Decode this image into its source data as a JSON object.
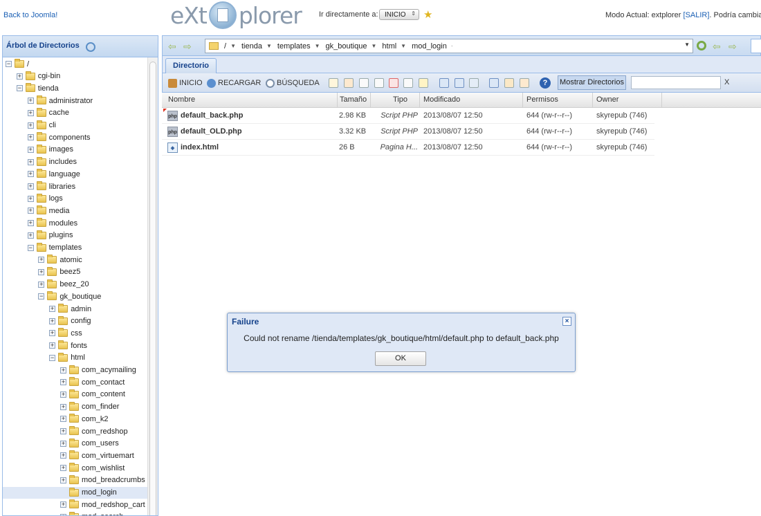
{
  "header": {
    "back_link": "Back to Joomla!",
    "logo_left": "eXt",
    "logo_right": "plorer",
    "goto_label": "Ir directamente a:",
    "goto_value": "INICIO",
    "mode_prefix": "Modo Actual: extplorer ",
    "mode_salir": "[SALIR]",
    "mode_suffix": ". Podría cambiar"
  },
  "tree": {
    "title": "Árbol de Directorios",
    "items": [
      {
        "label": "/",
        "level": 0,
        "toggle": "minus",
        "open": true
      },
      {
        "label": "cgi-bin",
        "level": 1,
        "toggle": "plus"
      },
      {
        "label": "tienda",
        "level": 1,
        "toggle": "minus",
        "open": true
      },
      {
        "label": "administrator",
        "level": 2,
        "toggle": "plus"
      },
      {
        "label": "cache",
        "level": 2,
        "toggle": "plus"
      },
      {
        "label": "cli",
        "level": 2,
        "toggle": "plus"
      },
      {
        "label": "components",
        "level": 2,
        "toggle": "plus"
      },
      {
        "label": "images",
        "level": 2,
        "toggle": "plus"
      },
      {
        "label": "includes",
        "level": 2,
        "toggle": "plus"
      },
      {
        "label": "language",
        "level": 2,
        "toggle": "plus"
      },
      {
        "label": "libraries",
        "level": 2,
        "toggle": "plus"
      },
      {
        "label": "logs",
        "level": 2,
        "toggle": "plus"
      },
      {
        "label": "media",
        "level": 2,
        "toggle": "plus"
      },
      {
        "label": "modules",
        "level": 2,
        "toggle": "plus"
      },
      {
        "label": "plugins",
        "level": 2,
        "toggle": "plus"
      },
      {
        "label": "templates",
        "level": 2,
        "toggle": "minus",
        "open": true
      },
      {
        "label": "atomic",
        "level": 3,
        "toggle": "plus"
      },
      {
        "label": "beez5",
        "level": 3,
        "toggle": "plus"
      },
      {
        "label": "beez_20",
        "level": 3,
        "toggle": "plus"
      },
      {
        "label": "gk_boutique",
        "level": 3,
        "toggle": "minus",
        "open": true
      },
      {
        "label": "admin",
        "level": 4,
        "toggle": "plus"
      },
      {
        "label": "config",
        "level": 4,
        "toggle": "plus"
      },
      {
        "label": "css",
        "level": 4,
        "toggle": "plus"
      },
      {
        "label": "fonts",
        "level": 4,
        "toggle": "plus"
      },
      {
        "label": "html",
        "level": 4,
        "toggle": "minus",
        "open": true
      },
      {
        "label": "com_acymailing",
        "level": 5,
        "toggle": "plus"
      },
      {
        "label": "com_contact",
        "level": 5,
        "toggle": "plus"
      },
      {
        "label": "com_content",
        "level": 5,
        "toggle": "plus"
      },
      {
        "label": "com_finder",
        "level": 5,
        "toggle": "plus"
      },
      {
        "label": "com_k2",
        "level": 5,
        "toggle": "plus"
      },
      {
        "label": "com_redshop",
        "level": 5,
        "toggle": "plus"
      },
      {
        "label": "com_users",
        "level": 5,
        "toggle": "plus"
      },
      {
        "label": "com_virtuemart",
        "level": 5,
        "toggle": "plus"
      },
      {
        "label": "com_wishlist",
        "level": 5,
        "toggle": "plus"
      },
      {
        "label": "mod_breadcrumbs",
        "level": 5,
        "toggle": "plus"
      },
      {
        "label": "mod_login",
        "level": 5,
        "toggle": "none",
        "selected": true
      },
      {
        "label": "mod_redshop_cart",
        "level": 5,
        "toggle": "plus"
      },
      {
        "label": "mod_search",
        "level": 5,
        "toggle": "plus"
      }
    ]
  },
  "path": {
    "crumbs": [
      "/",
      "tienda",
      "templates",
      "gk_boutique",
      "html",
      "mod_login"
    ]
  },
  "tab": {
    "label": "Directorio"
  },
  "toolbar": {
    "home_label": "INICIO",
    "reload_label": "RECARGAR",
    "search_label": "BÚSQUEDA",
    "show_dirs_label": "Mostrar Directorios",
    "filter_value": "",
    "clear_label": "X"
  },
  "grid": {
    "columns": [
      "Nombre",
      "Tamaño",
      "Tipo",
      "Modificado",
      "Permisos",
      "Owner"
    ],
    "rows": [
      {
        "name": "default_back.php",
        "icon": "php",
        "size": "2.98 KB",
        "type": "Script PHP",
        "modified": "2013/08/07 12:50",
        "perms": "644 (rw-r--r--)",
        "owner": "skyrepub (746)",
        "dirty": true
      },
      {
        "name": "default_OLD.php",
        "icon": "php",
        "size": "3.32 KB",
        "type": "Script PHP",
        "modified": "2013/08/07 12:50",
        "perms": "644 (rw-r--r--)",
        "owner": "skyrepub (746)"
      },
      {
        "name": "index.html",
        "icon": "html",
        "size": "26 B",
        "type": "Pagina H...",
        "modified": "2013/08/07 12:50",
        "perms": "644 (rw-r--r--)",
        "owner": "skyrepub (746)"
      }
    ]
  },
  "dialog": {
    "title": "Failure",
    "message": "Could not rename /tienda/templates/gk_boutique/html/default.php to default_back.php",
    "ok_label": "OK"
  },
  "colors": {
    "accent": "#15428b",
    "panel_border": "#99bbe8",
    "panel_bg": "#dfe8f6"
  }
}
